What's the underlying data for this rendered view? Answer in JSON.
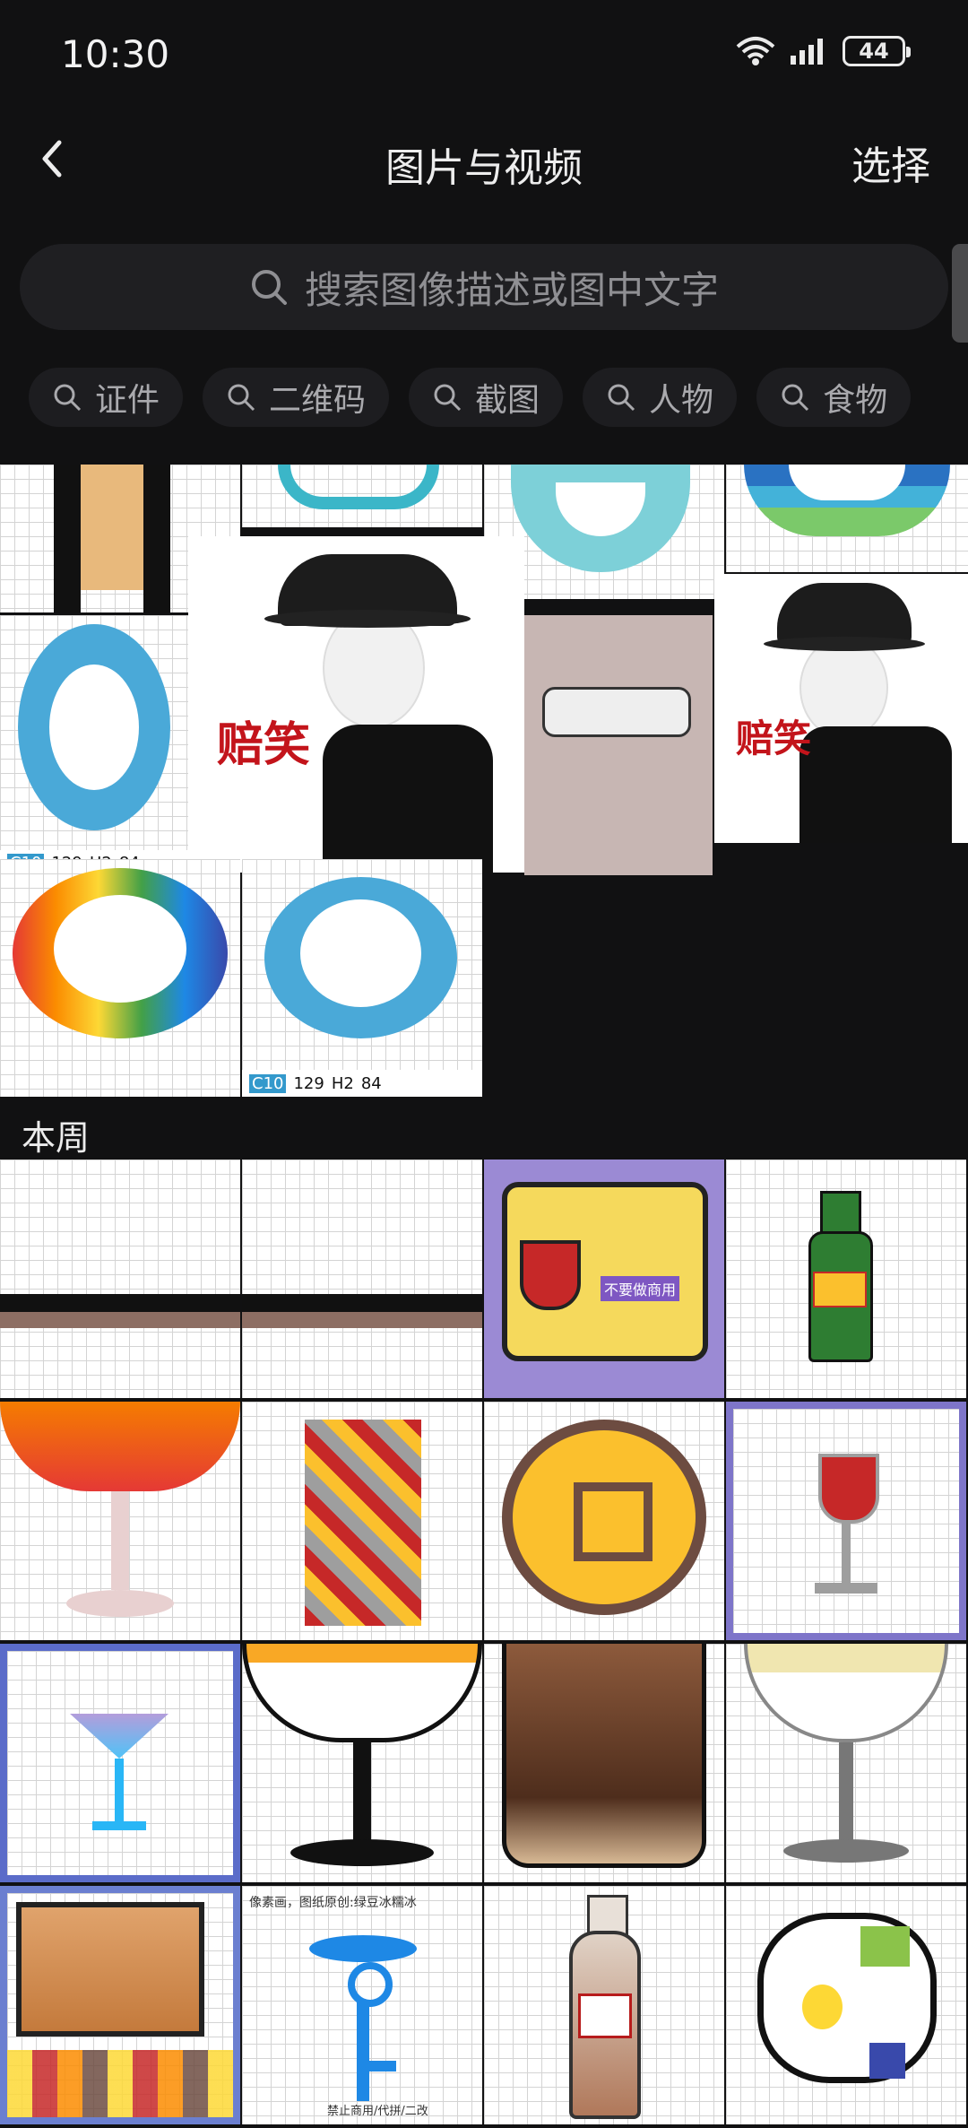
{
  "status": {
    "time": "10:30",
    "battery": "44"
  },
  "header": {
    "title": "图片与视频",
    "select_label": "选择"
  },
  "search": {
    "placeholder": "搜索图像描述或图中文字"
  },
  "chips": [
    {
      "label": "证件"
    },
    {
      "label": "二维码"
    },
    {
      "label": "截图"
    },
    {
      "label": "人物"
    },
    {
      "label": "食物"
    }
  ],
  "thumbs": {
    "meme1_caption": "赔笑",
    "meme2_caption": "赔笑",
    "smiley_footer_a": "C10",
    "smiley_footer_b": "129",
    "smiley_footer_c": "H2",
    "smiley_footer_d": "84",
    "smiley2_footer_a": "C10",
    "smiley2_footer_b": "129",
    "smiley2_footer_c": "H2",
    "smiley2_footer_d": "84"
  },
  "section": {
    "label": "本周"
  },
  "week": {
    "cell3_badge": "不要做商用",
    "cell14_title": "像素画，图纸原创:绿豆冰糯冰",
    "cell14_footer": "禁止商用/代拼/二改"
  },
  "colors": {
    "background": "#111112",
    "chip": "#1d1d20",
    "search": "#1f1f22"
  }
}
